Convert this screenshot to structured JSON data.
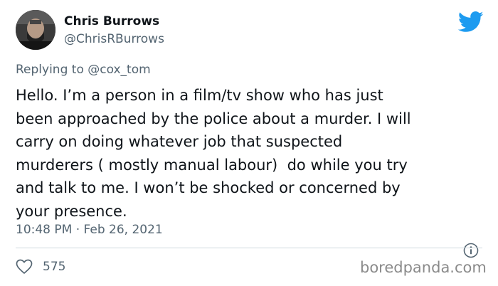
{
  "author": {
    "name": "Chris Burrows",
    "handle": "@ChrisRBurrows"
  },
  "reply": {
    "prefix": "Replying to ",
    "mention": "@cox_tom"
  },
  "tweet": {
    "lines": [
      "Hello. I’m a person in a film/tv show who has just",
      "been approached by the police about a murder. I will",
      "carry on doing whatever job that suspected",
      "murderers ( mostly manual labour)  do while you try",
      "and talk to me. I won’t be shocked or concerned by",
      "your presence."
    ],
    "timestamp": "10:48 PM · Feb 26, 2021",
    "like_count": "575"
  },
  "icons": {
    "brand": "twitter-bird-icon",
    "info": "info-icon",
    "like": "heart-icon"
  },
  "colors": {
    "twitter_blue": "#1d9bf0",
    "text_primary": "#0f1419",
    "text_secondary": "#536471"
  },
  "watermark": "boredpanda.com"
}
